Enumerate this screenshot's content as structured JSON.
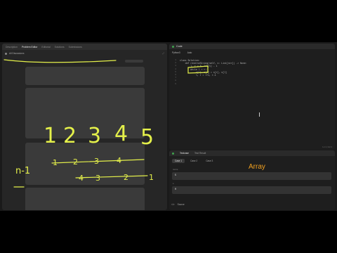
{
  "left": {
    "tabs": [
      "Description",
      "Problem Editor",
      "Editorial",
      "Solutions",
      "Submissions"
    ],
    "active_tab": 1,
    "subbar_text": "All Discussions"
  },
  "code": {
    "title": "Code",
    "language": "Python3",
    "mode": "Auto",
    "line_numbers": [
      "1",
      "2",
      "3",
      "4",
      "5",
      "6",
      "7",
      "8",
      "9"
    ],
    "lines": [
      "class Solution:",
      "    def reverseString(self, s: List[str]) -> None:",
      "        l, r = 0, len(s) - 1",
      "        while l < r:",
      "            s[l], s[r] = s[r], s[l]",
      "            l, r = l+1, r-1",
      "",
      "",
      ""
    ],
    "status": "Ln 1, Col 1"
  },
  "test": {
    "tabs": [
      "Testcase",
      "Test Result"
    ],
    "cases": [
      "Case 1",
      "Case 2",
      "Case 3"
    ],
    "field1_label": "nums",
    "field1_value": "5",
    "field2_label": "s",
    "field2_value": "0",
    "source_label": "Source"
  },
  "annotations": {
    "top_numbers": [
      "1",
      "2",
      "3",
      "4",
      "5"
    ],
    "row1": [
      "1",
      "2",
      "3",
      "4"
    ],
    "row2": [
      "4",
      "3",
      "2",
      "1"
    ],
    "n_minus_1": "n-1",
    "array_label": "Array",
    "ink_color": "#e4f04a",
    "array_color": "#f0a020"
  }
}
